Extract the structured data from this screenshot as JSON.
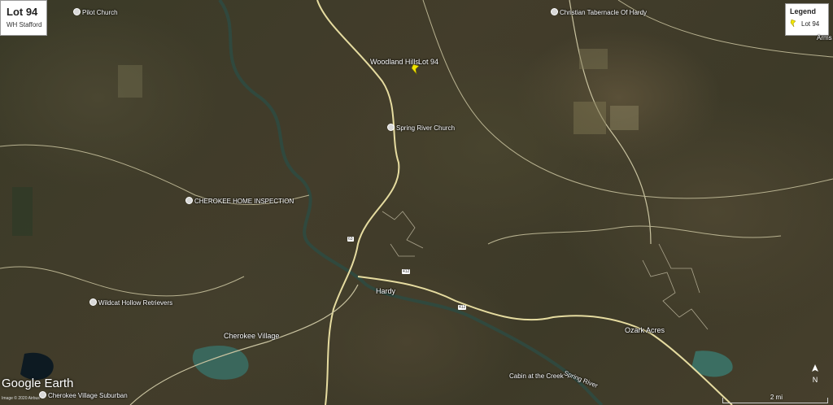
{
  "title": {
    "name": "Lot 94",
    "author": "WH Stafford"
  },
  "legend": {
    "title": "Legend",
    "item": "Lot 94"
  },
  "places": {
    "woodland_hills": "Woodland Hills",
    "lot_label": "Lot 94",
    "pilot_church": "Pilot Church",
    "christian_tabernacle": "Christian Tabernacle Of Hardy",
    "arms": "Arms",
    "spring_river_church": "Spring River Church",
    "cherokee_home_inspection": "CHEROKEE HOME INSPECTION",
    "hardy": "Hardy",
    "wildcat_hollow": "Wildcat Hollow Retrievers",
    "cherokee_village": "Cherokee Village",
    "ozark_acres": "Ozark Acres",
    "cabin": "Cabin at the Creek",
    "spring_river": "Spring River",
    "cherokee_suburban": "Cherokee Village Suburban"
  },
  "routes": {
    "r1": "63",
    "r2": "412",
    "r3": "412"
  },
  "branding": {
    "logo": "Google Earth",
    "copyright": "Image © 2020 Airbus"
  },
  "scale": {
    "label": "2 mi"
  },
  "north": {
    "label": "N"
  },
  "colors": {
    "pin": "#f2e600",
    "road": "#e8e0b0",
    "water": "#3f6f66"
  }
}
